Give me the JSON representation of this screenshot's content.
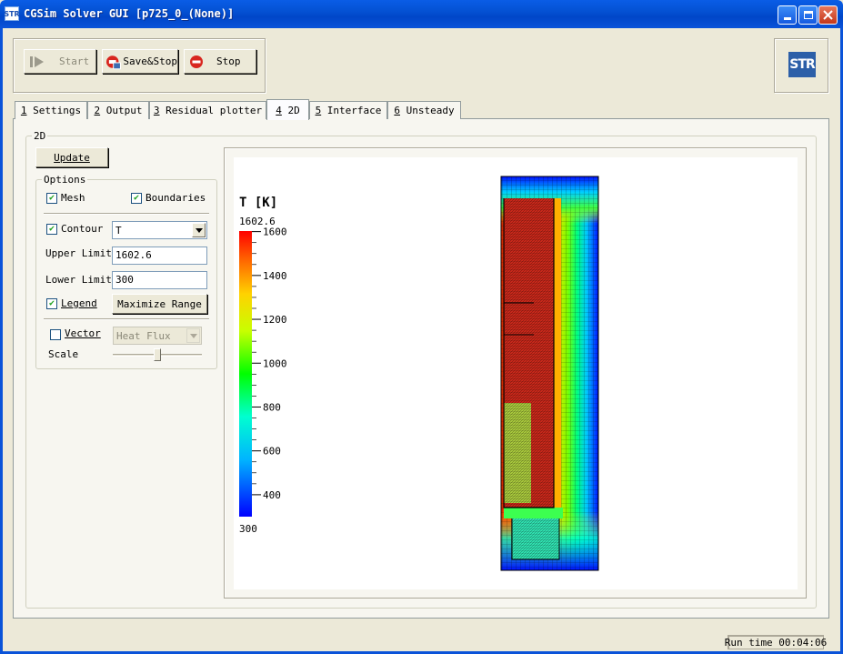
{
  "window": {
    "title": "CGSim Solver GUI [p725_0_(None)]",
    "app_icon": "STR"
  },
  "toolbar": {
    "start_label": "Start",
    "savestop_label": "Save&Stop",
    "stop_label": "Stop"
  },
  "logo": {
    "text": "STR"
  },
  "tabs": [
    {
      "key": "1",
      "label": " Settings"
    },
    {
      "key": "2",
      "label": " Output"
    },
    {
      "key": "3",
      "label": " Residual plotter"
    },
    {
      "key": "4",
      "label": " 2D"
    },
    {
      "key": "5",
      "label": " Interface"
    },
    {
      "key": "6",
      "label": " Unsteady"
    }
  ],
  "active_tab": "4",
  "panel": {
    "group_title": "2D",
    "update_label": "Update",
    "options_title": "Options",
    "mesh_label": "Mesh",
    "mesh_checked": true,
    "boundaries_label": "Boundaries",
    "boundaries_checked": true,
    "contour_label": "Contour",
    "contour_checked": true,
    "contour_value": "T",
    "upper_limit_label": "Upper Limit",
    "upper_limit_value": "1602.6",
    "lower_limit_label": "Lower Limit",
    "lower_limit_value": "300",
    "legend_label": "Legend",
    "legend_checked": true,
    "maximize_range_label": "Maximize Range",
    "vector_label": "Vector",
    "vector_checked": false,
    "vector_value": "Heat Flux",
    "scale_label": "Scale",
    "scale_level": 0.5
  },
  "plot": {
    "legend_title": "T [K]",
    "max_label": "1602.6",
    "min_label": "300",
    "ticks": [
      "1600",
      "1400",
      "1200",
      "1000",
      "800",
      "600",
      "400"
    ],
    "tick_values": [
      1600,
      1400,
      1200,
      1000,
      800,
      600,
      400
    ],
    "range": [
      300,
      1602.6
    ]
  },
  "status": {
    "runtime": "Run time 00:04:06"
  }
}
